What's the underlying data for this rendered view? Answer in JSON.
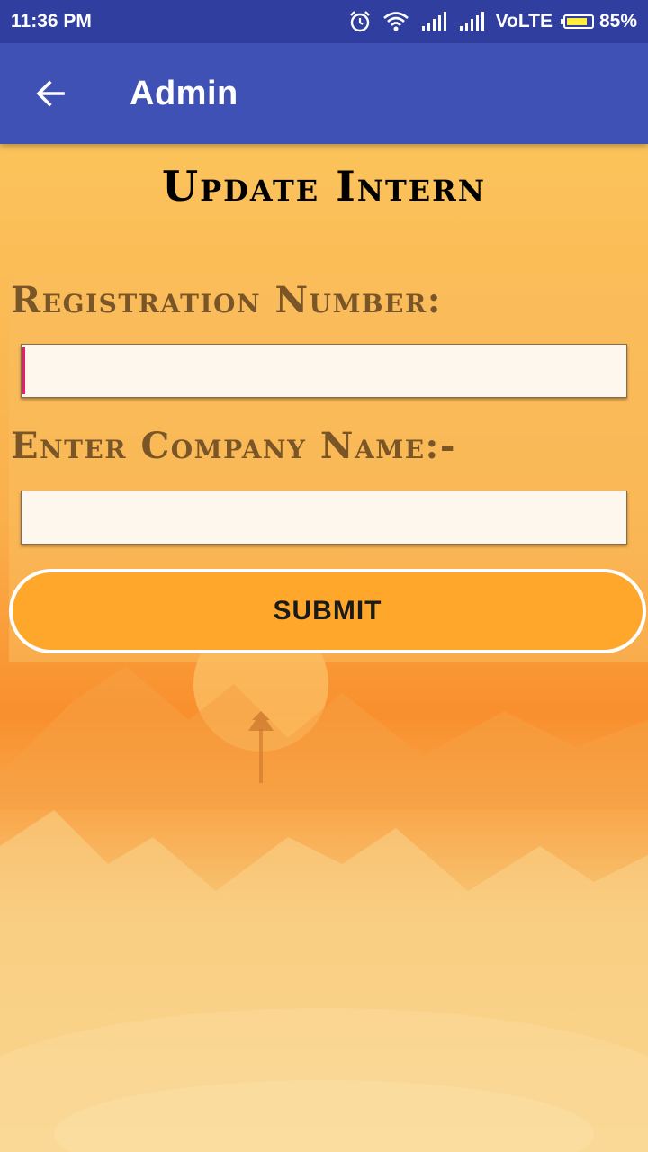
{
  "status_bar": {
    "time": "11:36 PM",
    "network_label": "VoLTE",
    "battery_percent": "85%",
    "battery_level": 0.85,
    "icons": [
      "alarm-icon",
      "wifi-icon",
      "signal-icon",
      "signal-icon",
      "battery-icon"
    ]
  },
  "app_bar": {
    "title": "Admin",
    "back_icon": "arrow-left-icon",
    "color": "#3f51b5"
  },
  "page": {
    "heading": "Update Intern"
  },
  "form": {
    "registration_label": "Registration Number:",
    "registration_value": "",
    "company_label": "Enter Company Name:-",
    "company_value": "",
    "submit_label": "SUBMIT",
    "submit_color": "#ffa72a"
  }
}
